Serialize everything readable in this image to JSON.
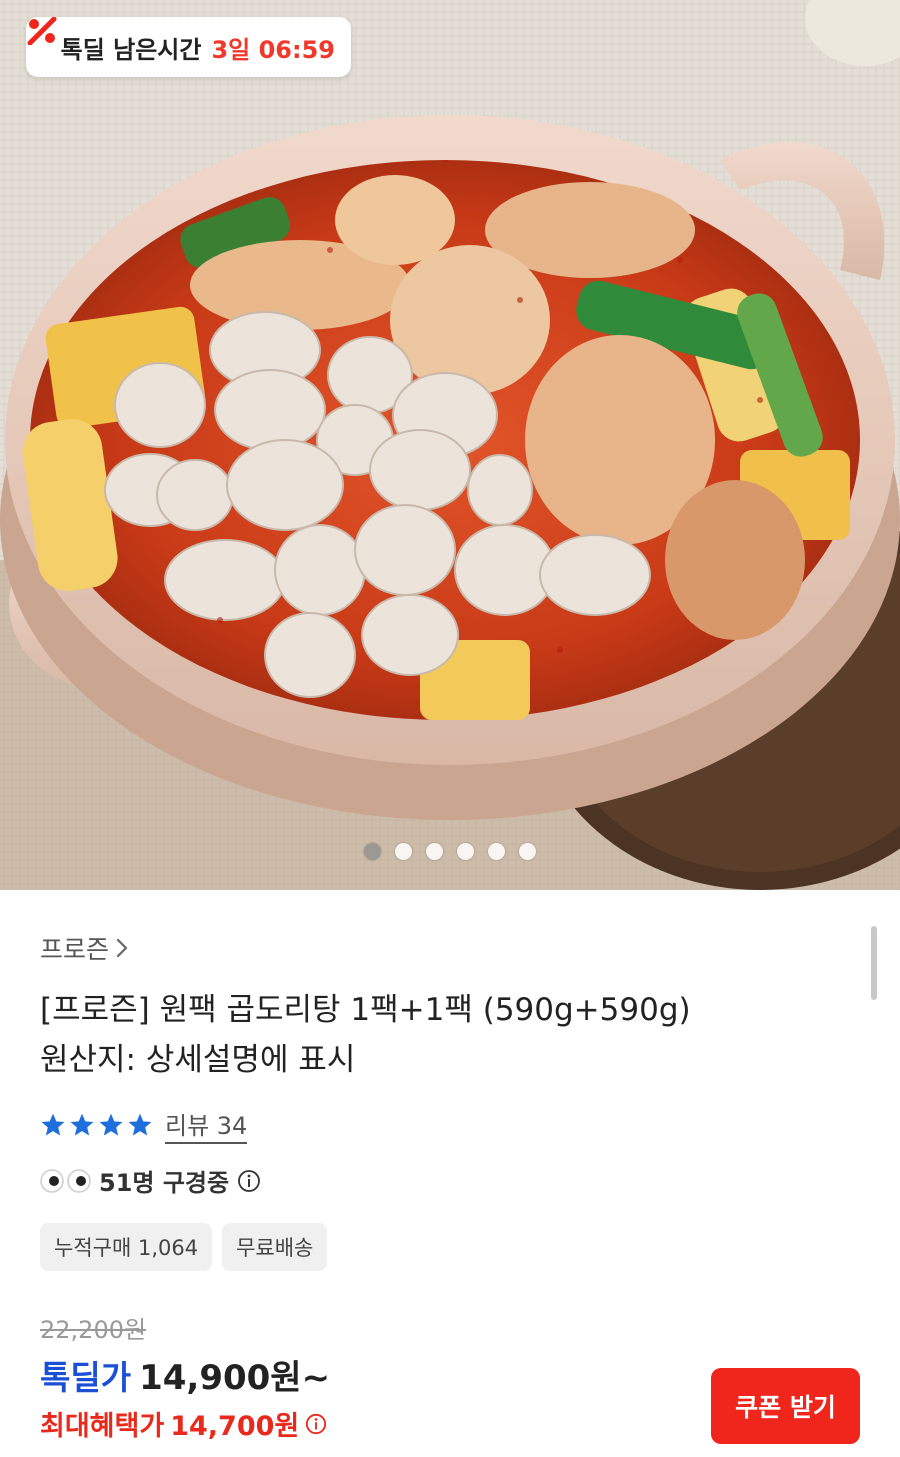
{
  "timer": {
    "label": "톡딜 남은시간",
    "value": "3일 06:59"
  },
  "carousel": {
    "total": 6,
    "active_index": 0
  },
  "product": {
    "category": "프로즌",
    "title_line1": "[프로즌] 원팩 곱도리탕 1팩+1팩 (590g+590g)",
    "title_line2": "원산지: 상세설명에 표시",
    "rating_stars": 4,
    "review_label": "리뷰 34",
    "viewing_text": "51명 구경중",
    "tags": [
      "누적구매 1,064",
      "무료배송"
    ],
    "original_price": "22,200원",
    "deal_label": "톡딜가",
    "deal_price": "14,900원~",
    "max_label": "최대혜택가",
    "max_price": "14,700원"
  },
  "actions": {
    "coupon_button": "쿠폰 받기"
  },
  "colors": {
    "accent_red": "#f0261c",
    "deal_blue": "#1a4fd6",
    "star_blue": "#1e6fdc"
  }
}
